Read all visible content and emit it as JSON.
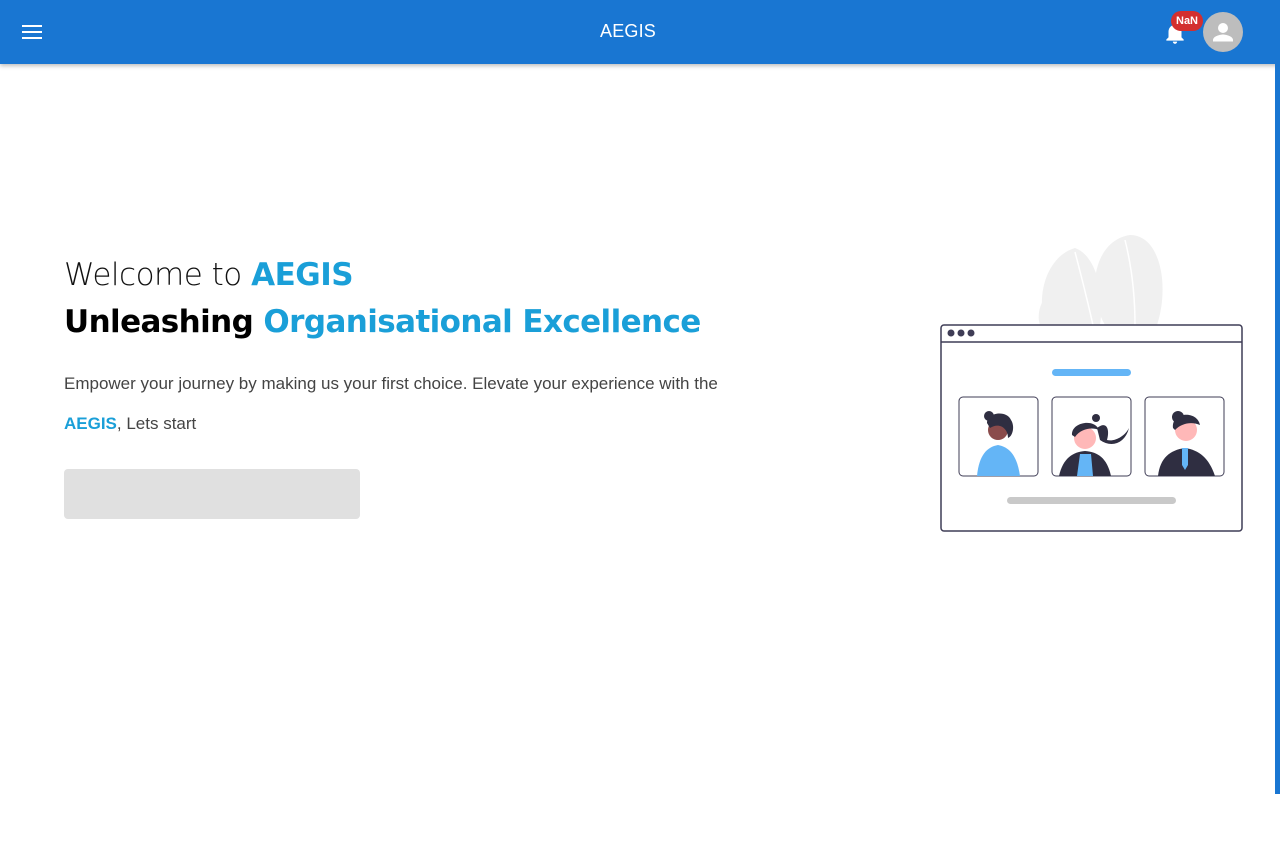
{
  "header": {
    "title": "AEGIS",
    "notification_badge": "NaN",
    "menu_icon": "hamburger-menu-icon",
    "bell_icon": "bell-icon",
    "avatar_icon": "person-icon"
  },
  "hero": {
    "welcome_prefix": "Welcome to ",
    "welcome_brand": "AEGIS",
    "tagline_prefix": "Unleashing ",
    "tagline_accent": "Organisational Excellence",
    "desc_line": "Empower your journey by making us your first choice. Elevate your experience with the ",
    "desc_brand": "AEGIS",
    "desc_suffix": ", Lets start",
    "cta_label": ""
  },
  "colors": {
    "app_bar": "#1976d2",
    "accent": "#1a9fd8",
    "badge": "#d32f2f",
    "cta": "#e0e0e0"
  }
}
